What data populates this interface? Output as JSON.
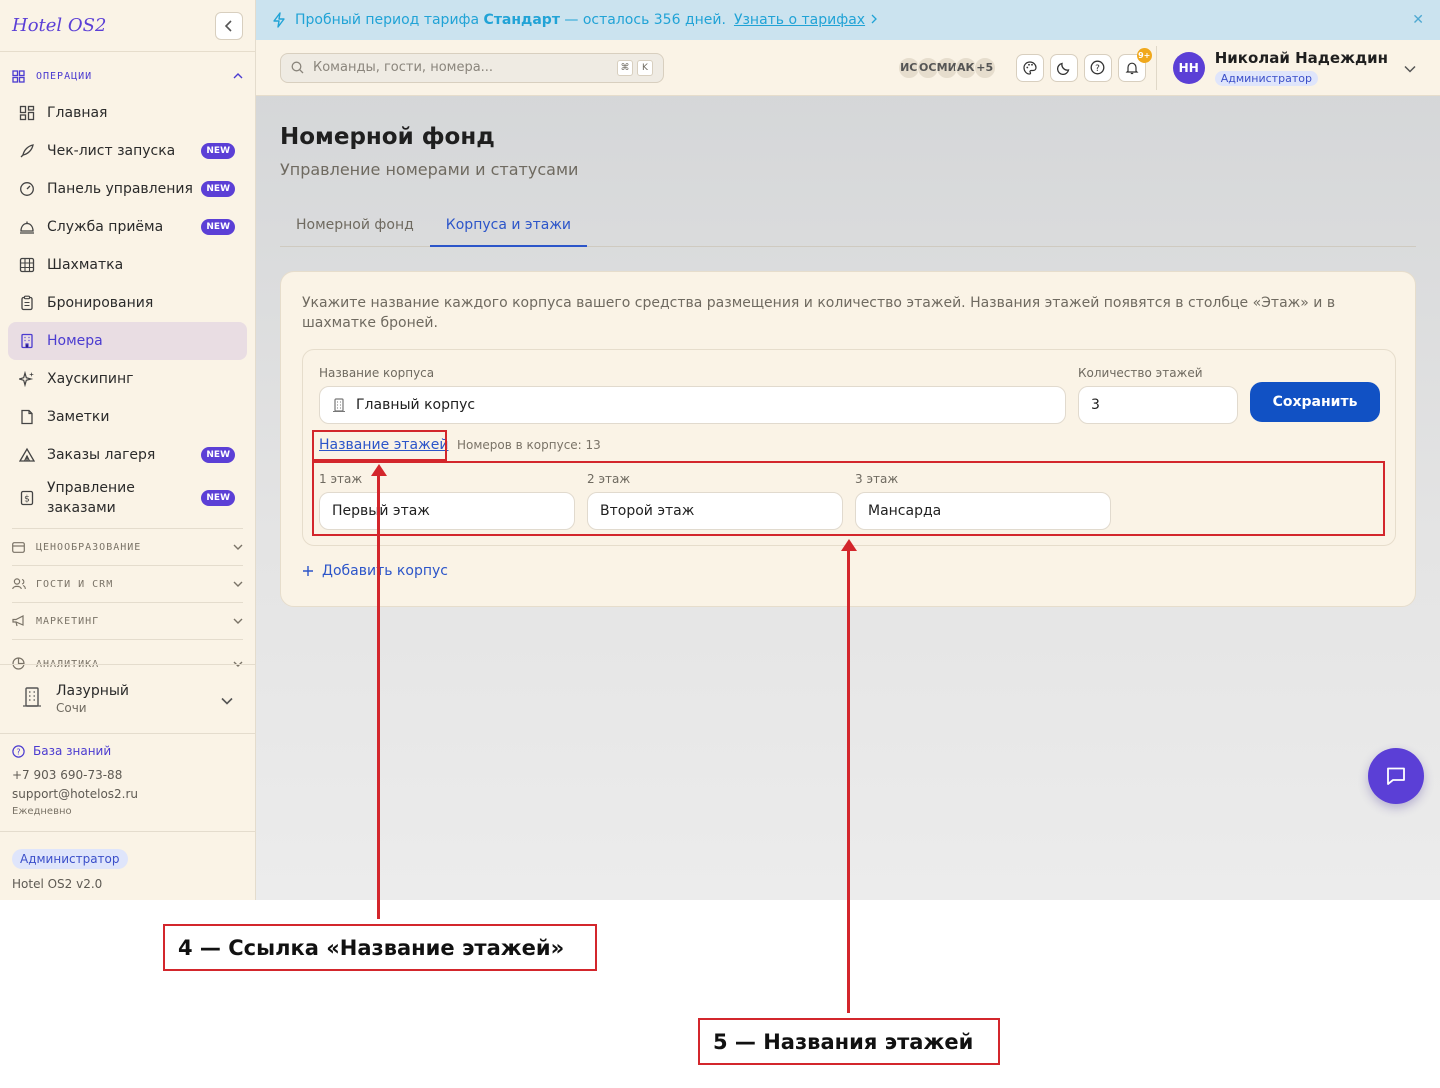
{
  "brand": "Hotel OS2",
  "sidebar": {
    "section_operations": "ОПЕРАЦИИ",
    "items": [
      {
        "label": "Главная",
        "badge": ""
      },
      {
        "label": "Чек-лист запуска",
        "badge": "NEW"
      },
      {
        "label": "Панель управления",
        "badge": "NEW"
      },
      {
        "label": "Служба приёма",
        "badge": "NEW"
      },
      {
        "label": "Шахматка",
        "badge": ""
      },
      {
        "label": "Бронирования",
        "badge": ""
      },
      {
        "label": "Номера",
        "badge": ""
      },
      {
        "label": "Хаускипинг",
        "badge": ""
      },
      {
        "label": "Заметки",
        "badge": ""
      },
      {
        "label": "Заказы лагеря",
        "badge": "NEW"
      },
      {
        "label_line1": "Управление",
        "label_line2": "заказами",
        "badge": "NEW"
      }
    ],
    "sections": [
      "ЦЕНООБРАЗОВАНИЕ",
      "ГОСТИ И CRM",
      "МАРКЕТИНГ",
      "АНАЛИТИКА"
    ],
    "hotel": {
      "name": "Лазурный",
      "city": "Сочи"
    },
    "support": {
      "kb": "База знаний",
      "phone": "+7 903 690-73-88",
      "email": "support@hotelos2.ru",
      "hours": "Ежедневно"
    },
    "role": "Администратор",
    "version": "Hotel OS2 v2.0"
  },
  "banner": {
    "prefix": "Пробный период тарифа",
    "plan": "Стандарт",
    "suffix": "— осталось 356 дней.",
    "link": "Узнать о тарифах",
    "close": "✕"
  },
  "topbar": {
    "search_placeholder": "Команды, гости, номера...",
    "kbd1": "⌘",
    "kbd2": "K",
    "avatars": [
      "ИС",
      "ОС",
      "МИ",
      "АК",
      "+5"
    ],
    "notif_count": "9+",
    "user": {
      "initials": "НН",
      "name": "Николай Надеждин",
      "role": "Администратор"
    }
  },
  "page": {
    "title": "Номерной фонд",
    "subtitle": "Управление номерами и статусами",
    "tabs": [
      "Номерной фонд",
      "Корпуса и этажи"
    ]
  },
  "card": {
    "description": "Укажите название каждого корпуса вашего средства размещения и количество этажей. Названия этажей появятся в столбце «Этаж» и в шахматке броней.",
    "building_label": "Название корпуса",
    "building_value": "Главный корпус",
    "floors_label": "Количество этажей",
    "floors_value": "3",
    "save": "Сохранить",
    "floor_names_link": "Название этажей",
    "rooms_count": "Номеров в корпусе: 13",
    "floors": [
      {
        "label": "1 этаж",
        "value": "Первый этаж"
      },
      {
        "label": "2 этаж",
        "value": "Второй этаж"
      },
      {
        "label": "3 этаж",
        "value": "Мансарда"
      }
    ],
    "add_building": "Добавить корпус"
  },
  "annotations": {
    "a4": "4 — Ссылка «Название этажей»",
    "a5": "5 — Названия этажей"
  },
  "colors": {
    "accent": "#5b3fd6",
    "primary": "#1151c4",
    "annotation": "#d3262c",
    "sidebar_bg": "#faf3e6"
  }
}
